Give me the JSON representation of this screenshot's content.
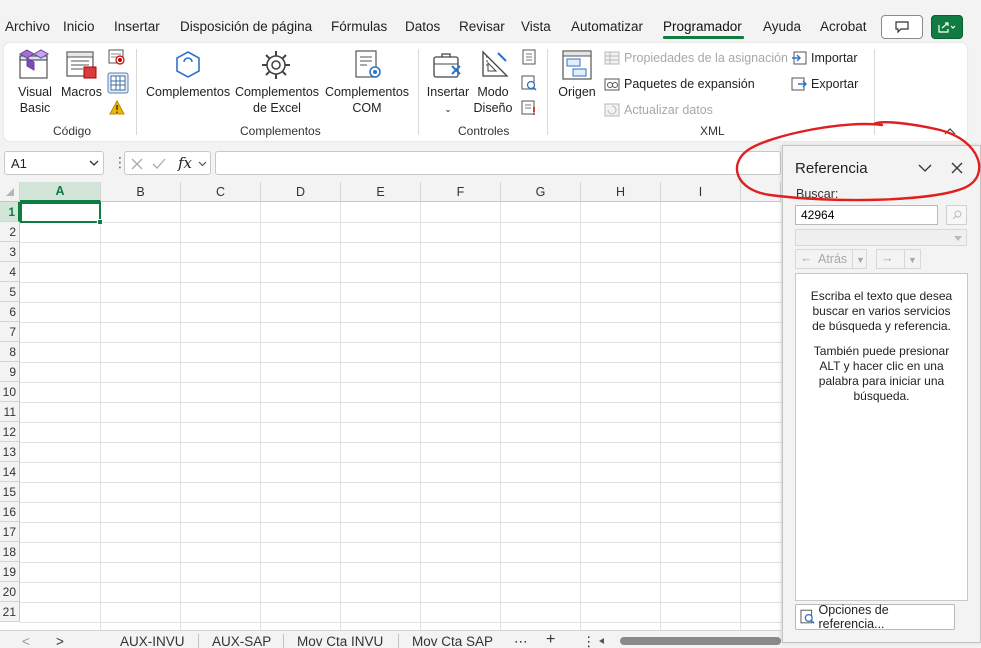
{
  "tabs": [
    {
      "label": "Archivo",
      "active": false
    },
    {
      "label": "Inicio",
      "active": false
    },
    {
      "label": "Insertar",
      "active": false
    },
    {
      "label": "Disposición de página",
      "active": false
    },
    {
      "label": "Fórmulas",
      "active": false
    },
    {
      "label": "Datos",
      "active": false
    },
    {
      "label": "Revisar",
      "active": false
    },
    {
      "label": "Vista",
      "active": false
    },
    {
      "label": "Automatizar",
      "active": false
    },
    {
      "label": "Programador",
      "active": true
    },
    {
      "label": "Ayuda",
      "active": false
    },
    {
      "label": "Acrobat",
      "active": false
    }
  ],
  "ribbon": {
    "codigo": {
      "name": "Código",
      "visual_basic": "Visual\nBasic",
      "macros": "Macros"
    },
    "complementos": {
      "name": "Complementos",
      "comp": "Complementos",
      "comp_excel": "Complementos\nde Excel",
      "comp_com": "Complementos\nCOM"
    },
    "controles": {
      "name": "Controles",
      "insertar": "Insertar",
      "modo_diseno": "Modo\nDiseño"
    },
    "xml": {
      "name": "XML",
      "origen": "Origen",
      "propiedades": "Propiedades de la asignación",
      "paquetes": "Paquetes de expansión",
      "actualizar": "Actualizar datos",
      "importar": "Importar",
      "exportar": "Exportar"
    }
  },
  "formula_bar": {
    "name_box": "A1",
    "fx": "fx",
    "value": ""
  },
  "grid": {
    "columns": [
      "A",
      "B",
      "C",
      "D",
      "E",
      "F",
      "G",
      "H",
      "I"
    ],
    "rows": [
      "1",
      "2",
      "3",
      "4",
      "5",
      "6",
      "7",
      "8",
      "9",
      "10",
      "11",
      "12",
      "13",
      "14",
      "15",
      "16",
      "17",
      "18",
      "19",
      "20",
      "21"
    ],
    "selected_cell": "A1"
  },
  "sheets": [
    "AUX-INVU",
    "AUX-SAP",
    "Mov Cta INVU",
    "Mov Cta SAP"
  ],
  "pane": {
    "title": "Referencia",
    "search_label": "Buscar:",
    "search_value": "42964",
    "back_label": "Atrás",
    "help_p1": "Escriba el texto que desea buscar en varios servicios de búsqueda y referencia.",
    "help_p2": "También puede presionar ALT y hacer clic en una palabra para iniciar una búsqueda.",
    "options_label": "Opciones de referencia..."
  },
  "colors": {
    "accent": "#107c41",
    "annotation": "#e02020"
  },
  "icons": [
    "comment-icon",
    "share-icon",
    "visual-basic-icon",
    "macros-icon",
    "record-macro-icon",
    "relative-refs-icon",
    "macro-security-icon",
    "addins-icon",
    "excel-addins-icon",
    "com-addins-icon",
    "insert-controls-icon",
    "design-mode-icon",
    "properties-icon",
    "view-code-icon",
    "run-dialog-icon",
    "source-icon",
    "import-icon",
    "export-icon",
    "search-go-icon",
    "back-arrow-icon",
    "forward-arrow-icon",
    "close-icon",
    "chevron-down-icon"
  ]
}
